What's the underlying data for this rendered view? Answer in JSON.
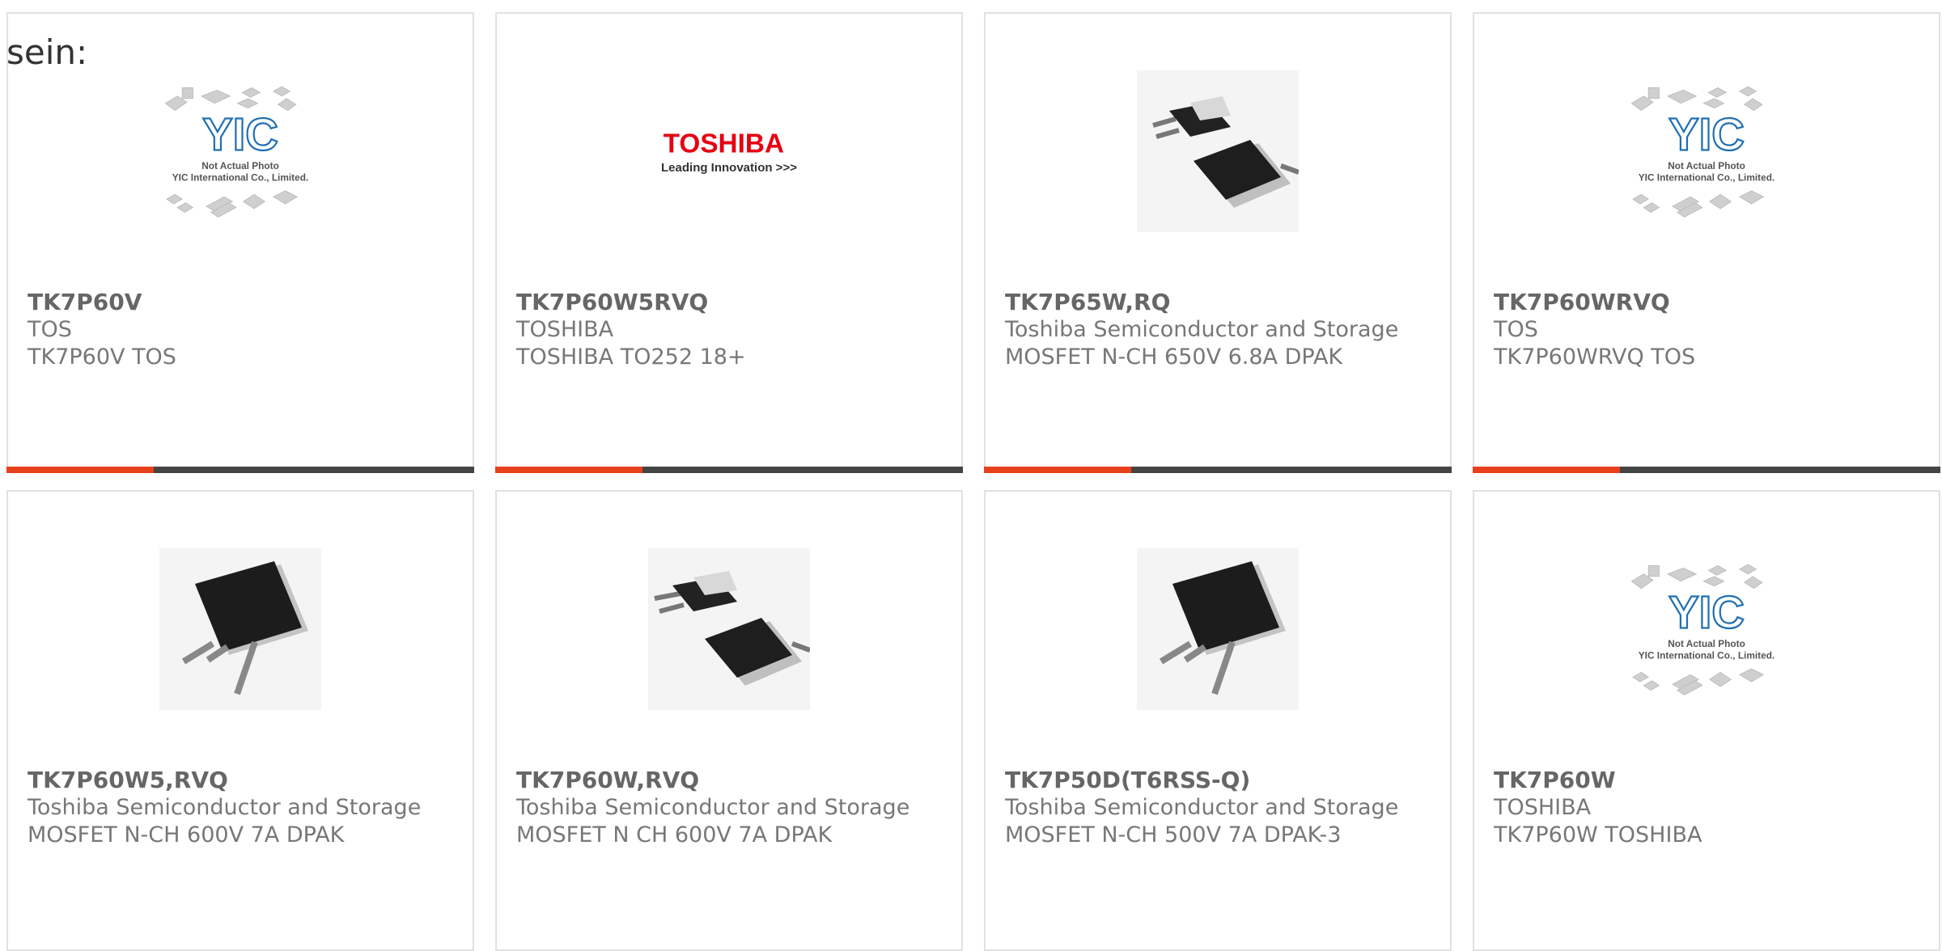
{
  "prefix_text": "sein:",
  "colors": {
    "accent": "#e8401c",
    "bar": "#444444",
    "yic_blue": "#1f6fb2",
    "toshiba_red": "#e60012"
  },
  "placeholder": {
    "line1": "Not Actual Photo",
    "line2": "YIC International Co., Limited.",
    "logo": "YIC"
  },
  "toshiba_logo": {
    "wordmark": "TOSHIBA",
    "tagline": "Leading Innovation >>>"
  },
  "products": [
    {
      "part": "TK7P60V",
      "brand": "TOS",
      "desc": "TK7P60V TOS",
      "image": "placeholder"
    },
    {
      "part": "TK7P60W5RVQ",
      "brand": "TOSHIBA",
      "desc": "TOSHIBA TO252 18+",
      "image": "toshiba-logo"
    },
    {
      "part": "TK7P65W,RQ",
      "brand": "Toshiba Semiconductor and Storage",
      "desc": "MOSFET N-CH 650V 6.8A DPAK",
      "image": "dpak-pair"
    },
    {
      "part": "TK7P60WRVQ",
      "brand": "TOS",
      "desc": "TK7P60WRVQ TOS",
      "image": "placeholder"
    },
    {
      "part": "TK7P60W5,RVQ",
      "brand": "Toshiba Semiconductor and Storage",
      "desc": "MOSFET N-CH 600V 7A DPAK",
      "image": "dpak-single"
    },
    {
      "part": "TK7P60W,RVQ",
      "brand": "Toshiba Semiconductor and Storage",
      "desc": "MOSFET N CH 600V 7A DPAK",
      "image": "dpak-pair"
    },
    {
      "part": "TK7P50D(T6RSS-Q)",
      "brand": "Toshiba Semiconductor and Storage",
      "desc": "MOSFET N-CH 500V 7A DPAK-3",
      "image": "dpak-single"
    },
    {
      "part": "TK7P60W",
      "brand": "TOSHIBA",
      "desc": "TK7P60W TOSHIBA",
      "image": "placeholder"
    }
  ]
}
